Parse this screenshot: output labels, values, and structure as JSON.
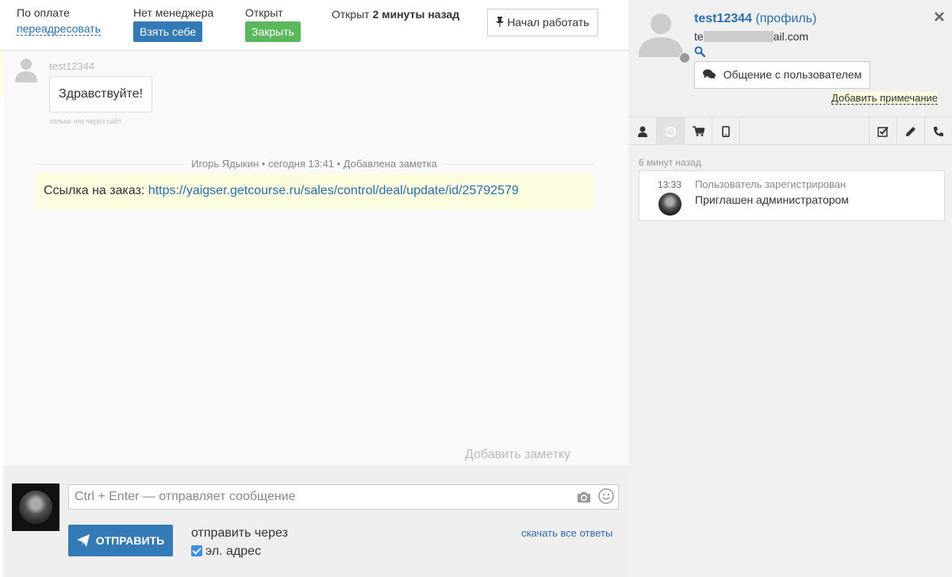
{
  "topbar": {
    "payment_label": "По оплате",
    "redirect_link": "переадресовать",
    "no_manager_label": "Нет менеджера",
    "take_button": "Взять себе",
    "open_label": "Открыт",
    "close_button": "Закрыть",
    "opened_prefix": "Открыт",
    "opened_ago": "2 минуты назад",
    "start_work_button": "Начал работать"
  },
  "chat": {
    "message": {
      "author": "test12344",
      "text": "Здравствуйте!",
      "meta": "только что через сайт"
    },
    "note_separator": "Игорь Ядыкин • сегодня 13:41 • Добавлена заметка",
    "note": {
      "prefix": "Ссылка на заказ: ",
      "link": "https://yaigser.getcourse.ru/sales/control/deal/update/id/25792579"
    },
    "add_note": "Добавить заметку"
  },
  "composer": {
    "placeholder": "Ctrl + Enter — отправляет сообщение",
    "send_button": "ОТПРАВИТЬ",
    "send_via": "отправить через",
    "email_option": "эл. адрес",
    "download_answers": "скачать все ответы"
  },
  "profile": {
    "username": "test12344",
    "profile_link": "(профиль)",
    "email_start": "te",
    "email_end": "ail.com",
    "talk_button": "Общение с пользователем",
    "add_remark": "Добавить примечание"
  },
  "activity": {
    "ago": "6 минут назад",
    "event": {
      "time": "13:33",
      "title": "Пользователь зарегистрирован",
      "desc": "Приглашен администратором"
    }
  },
  "colors": {
    "link": "#2a6db2",
    "primary_button": "#337ab7",
    "success_button": "#5cb85c",
    "note_bg": "#fcfcde"
  }
}
